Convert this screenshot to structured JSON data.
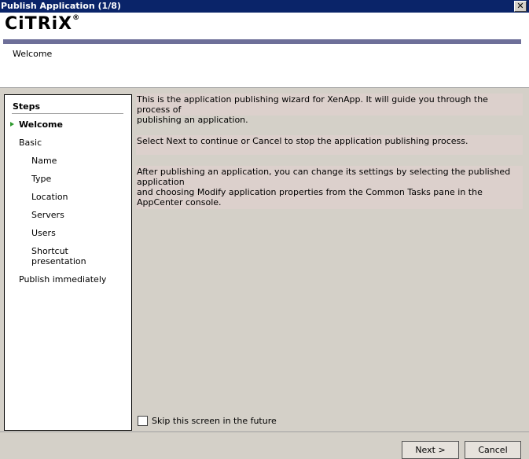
{
  "window": {
    "title": "Publish Application (1/8)",
    "close_glyph": "✕"
  },
  "header": {
    "logo": "CiTRiX",
    "logo_mark": "®",
    "page_title": "Welcome"
  },
  "steps": {
    "title": "Steps",
    "items": [
      {
        "label": "Welcome"
      },
      {
        "label": "Basic"
      },
      {
        "label": "Name"
      },
      {
        "label": "Type"
      },
      {
        "label": "Location"
      },
      {
        "label": "Servers"
      },
      {
        "label": "Users"
      },
      {
        "label": "Shortcut"
      },
      {
        "label": "presentation"
      },
      {
        "label": "Publish immediately"
      }
    ]
  },
  "content": {
    "para1_line1": "This is the application publishing wizard for XenApp.  It will guide you through the process of",
    "para1_line2": "publishing an application.",
    "para2": "Select Next to continue or Cancel to stop the application publishing process.",
    "para3_line1": "After publishing an application, you can change its settings by selecting the published application",
    "para3_line2": "and choosing Modify application properties from the Common Tasks pane in the AppCenter console.",
    "skip_label": "Skip this screen in the future"
  },
  "buttons": {
    "next": "Next >",
    "cancel": "Cancel"
  },
  "colors": {
    "titlebar": "#0a2469",
    "banner": "#6e6f99",
    "active_arrow": "#2e9a2e"
  }
}
